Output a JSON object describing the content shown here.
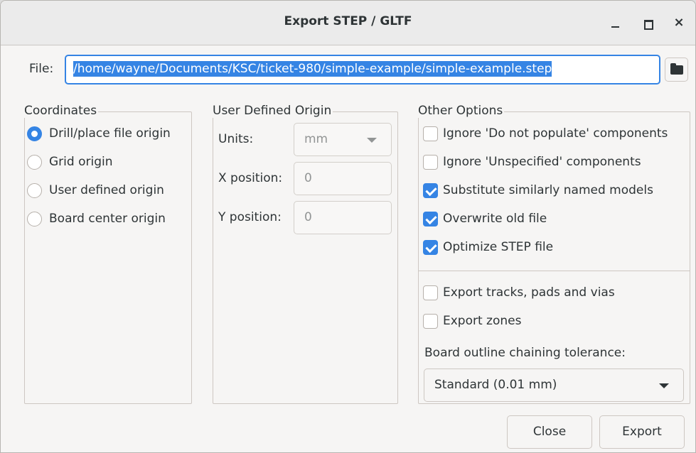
{
  "window": {
    "title": "Export STEP / GLTF",
    "controls": {
      "minimize": "minimize-icon",
      "maximize": "maximize-icon",
      "close": "×"
    }
  },
  "file": {
    "label": "File:",
    "value": "/home/wayne/Documents/KSC/ticket-980/simple-example/simple-example.step",
    "browse_icon": "folder-icon"
  },
  "coordinates": {
    "title": "Coordinates",
    "options": [
      {
        "label": "Drill/place file origin",
        "checked": true
      },
      {
        "label": "Grid origin",
        "checked": false
      },
      {
        "label": "User defined origin",
        "checked": false
      },
      {
        "label": "Board center origin",
        "checked": false
      }
    ]
  },
  "user_origin": {
    "title": "User Defined Origin",
    "units_label": "Units:",
    "units_value": "mm",
    "x_label": "X position:",
    "x_value": "0",
    "y_label": "Y position:",
    "y_value": "0"
  },
  "other_options": {
    "title": "Other Options",
    "checks": [
      {
        "label": "Ignore 'Do not populate' components",
        "checked": false
      },
      {
        "label": "Ignore 'Unspecified' components",
        "checked": false
      },
      {
        "label": "Substitute similarly named models",
        "checked": true
      },
      {
        "label": "Overwrite old file",
        "checked": true
      },
      {
        "label": "Optimize STEP file",
        "checked": true
      }
    ],
    "export_checks": [
      {
        "label": "Export tracks, pads and vias",
        "checked": false
      },
      {
        "label": "Export zones",
        "checked": false
      }
    ],
    "tolerance_label": "Board outline chaining tolerance:",
    "tolerance_value": "Standard (0.01 mm)"
  },
  "buttons": {
    "close": "Close",
    "export": "Export"
  },
  "colors": {
    "accent": "#3584e4",
    "background": "#f6f5f4"
  }
}
